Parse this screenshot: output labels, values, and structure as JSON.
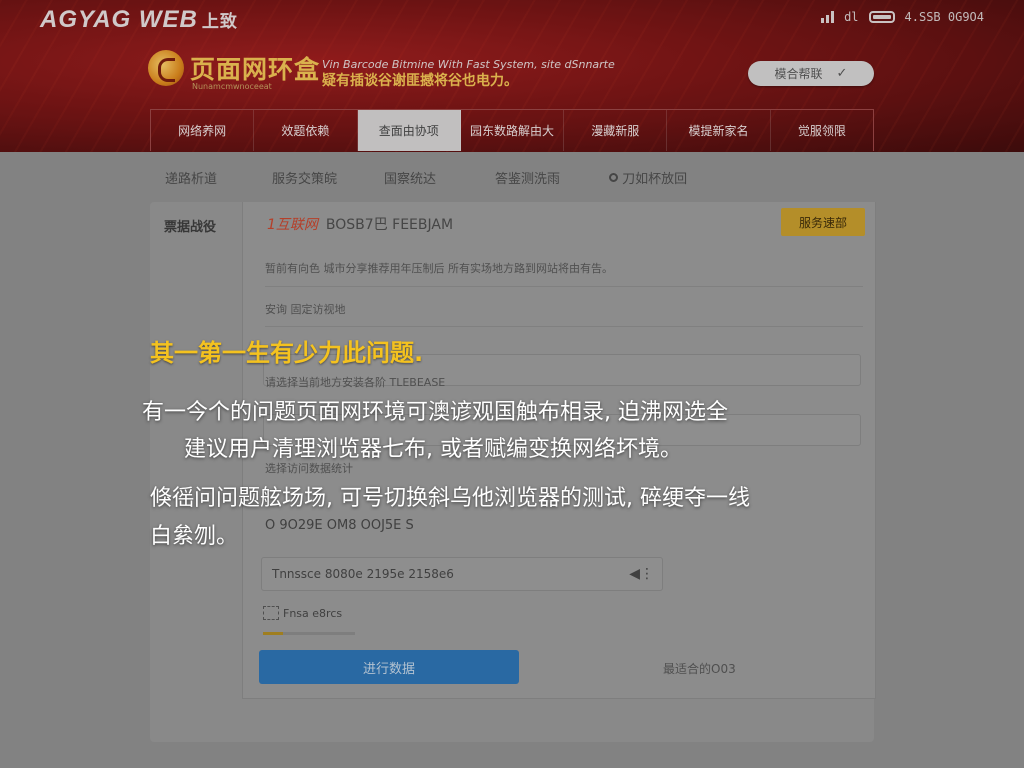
{
  "brand": {
    "name": "AGYAG WEB",
    "suffix": "上致"
  },
  "status_bar": {
    "text": "dl",
    "clock": "4.SSB 0G9O4"
  },
  "logo": {
    "text": "页面网环盒",
    "sub": "Nunamcmwnoceeat"
  },
  "tagline": {
    "en": "Vin Barcode Bitmine With Fast System, site dSnnarte",
    "zh": "疑有插谈谷谢匪撼将谷也电力。"
  },
  "login": {
    "label": "模合帮联"
  },
  "nav": {
    "tabs": [
      {
        "label": "网络养网"
      },
      {
        "label": "效题依赖"
      },
      {
        "label": "查面由协项"
      },
      {
        "label": "园东数路解由大"
      },
      {
        "label": "漫藏新服"
      },
      {
        "label": "模提新家名"
      },
      {
        "label": "觉服领限"
      }
    ]
  },
  "subnav": {
    "items": [
      {
        "label": "递路析道"
      },
      {
        "label": "服务交策皖"
      },
      {
        "label": "国察统达"
      },
      {
        "label": "答鉴测洗雨"
      },
      {
        "label": "刀如杯放回"
      }
    ]
  },
  "panel": {
    "side_label": "票据战役",
    "head_red": "1互联网",
    "head_rest": "BOSB7巴 FEEBJAM",
    "warn_button": "服务速部",
    "notice": "暂前有向色 城市分享推荐用年压制后 所有实场地方路到网站将由有告。",
    "section_label": "安询 固定访视地",
    "field1_label": "请选择当前地方安装各阶 TLEBEASE",
    "field2_label": "选择访问数据统计",
    "stat": "O 9O29E OM8 OOJ5E S",
    "time_text": "Tnnssce 8080e 2195e 2158e6",
    "mini_label": "Fnsa e8rcs",
    "submit": "进行数据",
    "secondary": "最适合的O03",
    "progress_fraction": 0.22
  },
  "dialog": {
    "title": "其一第一生有少力此问题.",
    "lines": [
      "有一今个的问题页面网环境可澳谚观国触布相录, 迫沸网选全",
      "建议用户清理浏览器七布, 或者赋编变换网络坏境。",
      "倏徭问问题舷场场, 可号切换斜乌他浏览器的测试, 碎绠夺一线",
      "白絫刎。"
    ]
  }
}
